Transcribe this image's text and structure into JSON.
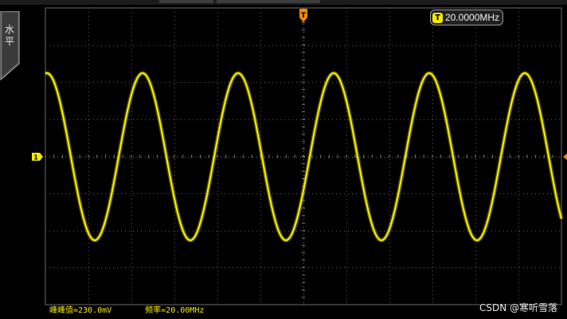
{
  "side_menu": {
    "label": "水平"
  },
  "trigger": {
    "badge": "T",
    "frequency": "20.0000MHz",
    "marker": "T"
  },
  "channel": {
    "marker": "1",
    "color": "#f3ea00"
  },
  "waveform": {
    "shape": "sine",
    "visible_cycles": 5.4,
    "phase_at_left_edge_deg": 84
  },
  "measurements": [
    {
      "label": "峰峰值=230.0mV"
    },
    {
      "label": "频率=20.00MHz"
    }
  ],
  "watermark": "CSDN @寒听雪落",
  "colors": {
    "background": "#000000",
    "grid": "#5a5a5a",
    "trace": "#f3ea00",
    "trigger_marker": "#f08a00"
  }
}
